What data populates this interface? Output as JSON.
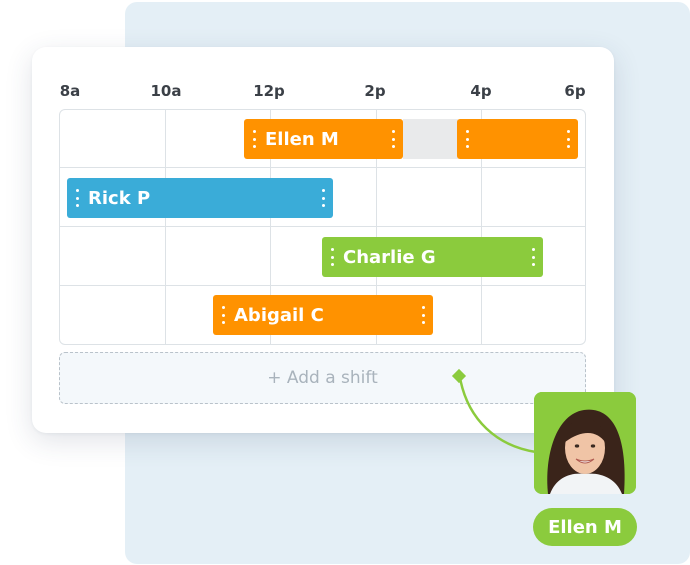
{
  "timeline": {
    "labels": [
      "8a",
      "10a",
      "12p",
      "2p",
      "4p",
      "6p"
    ]
  },
  "shifts": [
    {
      "name": "Ellen M",
      "color": "#ff9200"
    },
    {
      "name": "",
      "color": "#ff9200"
    },
    {
      "name": "Rick P",
      "color": "#3aacd8"
    },
    {
      "name": "Charlie G",
      "color": "#8bcb3d"
    },
    {
      "name": "Abigail C",
      "color": "#ff9200"
    }
  ],
  "add_shift": {
    "label": "+ Add a shift"
  },
  "assignee": {
    "name": "Ellen M"
  },
  "colors": {
    "orange": "#ff9200",
    "blue": "#3aacd8",
    "green": "#8bcb3d",
    "panel": "#e4eff6"
  },
  "icons": [
    "drag-handle-icon",
    "connector-diamond-icon"
  ]
}
